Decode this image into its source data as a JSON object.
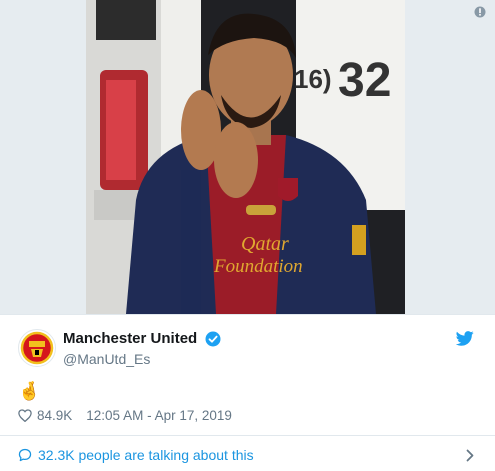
{
  "tweet": {
    "display_name": "Manchester United",
    "handle": "@ManUtd_Es",
    "verified": true,
    "text": "🤞",
    "likes": "84.9K",
    "timestamp": "12:05 AM - Apr 17, 2019",
    "talking_text": "32.3K people are talking about this"
  },
  "photo": {
    "van_number": "32",
    "van_text": "16)",
    "shirt_sponsor_line1": "Qatar",
    "shirt_sponsor_line2": "Foundation"
  },
  "colors": {
    "link_blue": "#1b95e0",
    "verified_blue": "#1da1f2",
    "muted_gray": "#657786",
    "divider": "#e1e8ed"
  },
  "icons": [
    "info-icon",
    "verified-badge-icon",
    "twitter-bird-icon",
    "heart-icon",
    "speech-bubble-icon",
    "chevron-right-icon"
  ]
}
